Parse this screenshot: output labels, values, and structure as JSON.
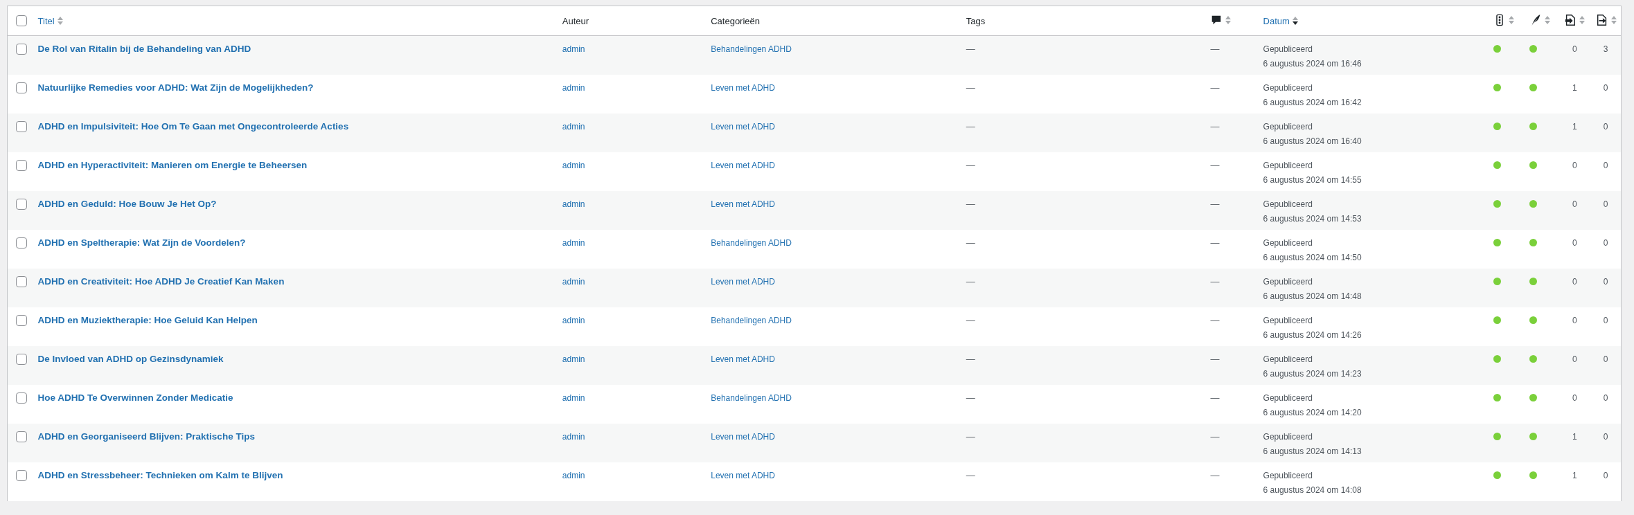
{
  "table": {
    "columns": [
      {
        "kind": "check",
        "checked": false
      },
      {
        "kind": "title",
        "label": "Titel",
        "sortable": true,
        "sorted": false
      },
      {
        "kind": "text",
        "label": "Auteur",
        "sortable": false
      },
      {
        "kind": "text",
        "label": "Categorieën",
        "sortable": false
      },
      {
        "kind": "text",
        "label": "Tags",
        "sortable": false
      },
      {
        "kind": "comments",
        "sortable": true,
        "sorted": false
      },
      {
        "kind": "date",
        "label": "Datum",
        "sortable": true,
        "sorted": true
      },
      {
        "kind": "seo",
        "sortable": true,
        "sorted": false
      },
      {
        "kind": "readability",
        "sortable": true,
        "sorted": false
      },
      {
        "kind": "links_out",
        "sortable": true,
        "sorted": false
      },
      {
        "kind": "links_in",
        "sortable": true,
        "sorted": false
      }
    ],
    "rows": [
      {
        "checked": false,
        "title": "De Rol van Ritalin bij de Behandeling van ADHD",
        "author": "admin",
        "category": "Behandelingen ADHD",
        "tags": "—",
        "comments": "—",
        "status": "Gepubliceerd",
        "date": "6 augustus 2024 om 16:46",
        "seo": {
          "color": "#7ad03a"
        },
        "readability": {
          "color": "#7ad03a"
        },
        "links_out": "0",
        "links_in": "3"
      },
      {
        "checked": false,
        "title": "Natuurlijke Remedies voor ADHD: Wat Zijn de Mogelijkheden?",
        "author": "admin",
        "category": "Leven met ADHD",
        "tags": "—",
        "comments": "—",
        "status": "Gepubliceerd",
        "date": "6 augustus 2024 om 16:42",
        "seo": {
          "color": "#7ad03a"
        },
        "readability": {
          "color": "#7ad03a"
        },
        "links_out": "1",
        "links_in": "0"
      },
      {
        "checked": false,
        "title": "ADHD en Impulsiviteit: Hoe Om Te Gaan met Ongecontroleerde Acties",
        "author": "admin",
        "category": "Leven met ADHD",
        "tags": "—",
        "comments": "—",
        "status": "Gepubliceerd",
        "date": "6 augustus 2024 om 16:40",
        "seo": {
          "color": "#7ad03a"
        },
        "readability": {
          "color": "#7ad03a"
        },
        "links_out": "1",
        "links_in": "0"
      },
      {
        "checked": false,
        "title": "ADHD en Hyperactiviteit: Manieren om Energie te Beheersen",
        "author": "admin",
        "category": "Leven met ADHD",
        "tags": "—",
        "comments": "—",
        "status": "Gepubliceerd",
        "date": "6 augustus 2024 om 14:55",
        "seo": {
          "color": "#7ad03a"
        },
        "readability": {
          "color": "#7ad03a"
        },
        "links_out": "0",
        "links_in": "0"
      },
      {
        "checked": false,
        "title": "ADHD en Geduld: Hoe Bouw Je Het Op?",
        "author": "admin",
        "category": "Leven met ADHD",
        "tags": "—",
        "comments": "—",
        "status": "Gepubliceerd",
        "date": "6 augustus 2024 om 14:53",
        "seo": {
          "color": "#7ad03a"
        },
        "readability": {
          "color": "#7ad03a"
        },
        "links_out": "0",
        "links_in": "0"
      },
      {
        "checked": false,
        "title": "ADHD en Speltherapie: Wat Zijn de Voordelen?",
        "author": "admin",
        "category": "Behandelingen ADHD",
        "tags": "—",
        "comments": "—",
        "status": "Gepubliceerd",
        "date": "6 augustus 2024 om 14:50",
        "seo": {
          "color": "#7ad03a"
        },
        "readability": {
          "color": "#7ad03a"
        },
        "links_out": "0",
        "links_in": "0"
      },
      {
        "checked": false,
        "title": "ADHD en Creativiteit: Hoe ADHD Je Creatief Kan Maken",
        "author": "admin",
        "category": "Leven met ADHD",
        "tags": "—",
        "comments": "—",
        "status": "Gepubliceerd",
        "date": "6 augustus 2024 om 14:48",
        "seo": {
          "color": "#7ad03a"
        },
        "readability": {
          "color": "#7ad03a"
        },
        "links_out": "0",
        "links_in": "0"
      },
      {
        "checked": false,
        "title": "ADHD en Muziektherapie: Hoe Geluid Kan Helpen",
        "author": "admin",
        "category": "Behandelingen ADHD",
        "tags": "—",
        "comments": "—",
        "status": "Gepubliceerd",
        "date": "6 augustus 2024 om 14:26",
        "seo": {
          "color": "#7ad03a"
        },
        "readability": {
          "color": "#7ad03a"
        },
        "links_out": "0",
        "links_in": "0"
      },
      {
        "checked": false,
        "title": "De Invloed van ADHD op Gezinsdynamiek",
        "author": "admin",
        "category": "Leven met ADHD",
        "tags": "—",
        "comments": "—",
        "status": "Gepubliceerd",
        "date": "6 augustus 2024 om 14:23",
        "seo": {
          "color": "#7ad03a"
        },
        "readability": {
          "color": "#7ad03a"
        },
        "links_out": "0",
        "links_in": "0"
      },
      {
        "checked": false,
        "title": "Hoe ADHD Te Overwinnen Zonder Medicatie",
        "author": "admin",
        "category": "Behandelingen ADHD",
        "tags": "—",
        "comments": "—",
        "status": "Gepubliceerd",
        "date": "6 augustus 2024 om 14:20",
        "seo": {
          "color": "#7ad03a"
        },
        "readability": {
          "color": "#7ad03a"
        },
        "links_out": "0",
        "links_in": "0"
      },
      {
        "checked": false,
        "title": "ADHD en Georganiseerd Blijven: Praktische Tips",
        "author": "admin",
        "category": "Leven met ADHD",
        "tags": "—",
        "comments": "—",
        "status": "Gepubliceerd",
        "date": "6 augustus 2024 om 14:13",
        "seo": {
          "color": "#7ad03a"
        },
        "readability": {
          "color": "#7ad03a"
        },
        "links_out": "1",
        "links_in": "0"
      },
      {
        "checked": false,
        "title": "ADHD en Stressbeheer: Technieken om Kalm te Blijven",
        "author": "admin",
        "category": "Leven met ADHD",
        "tags": "—",
        "comments": "—",
        "status": "Gepubliceerd",
        "date": "6 augustus 2024 om 14:08",
        "seo": {
          "color": "#7ad03a"
        },
        "readability": {
          "color": "#7ad03a"
        },
        "links_out": "1",
        "links_in": "0"
      }
    ]
  }
}
